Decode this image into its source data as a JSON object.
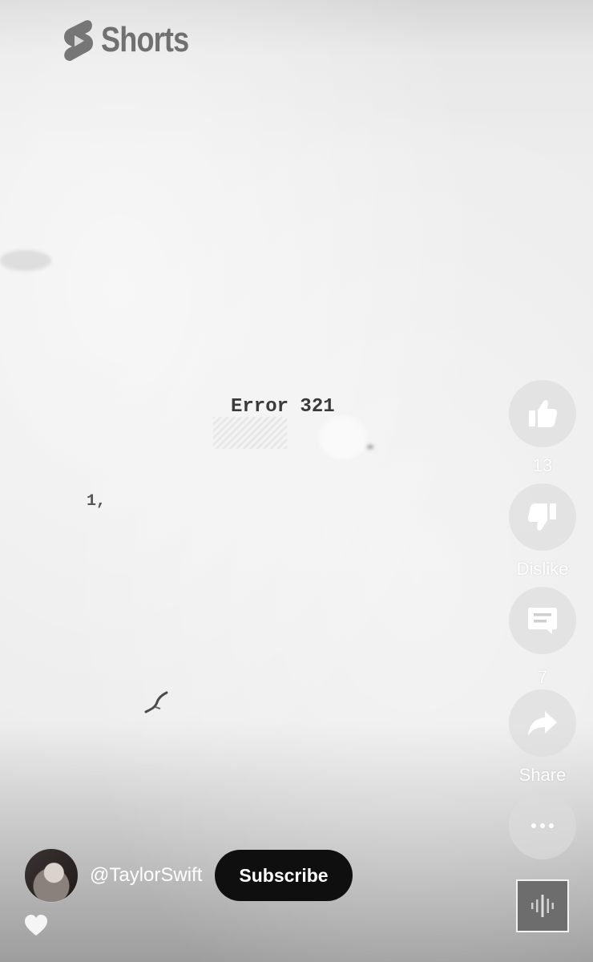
{
  "header": {
    "logo_text": "Shorts"
  },
  "video": {
    "typed_text_main": "Error 321",
    "typed_text_small": "1,"
  },
  "actions": {
    "like": {
      "icon": "thumbs-up-icon",
      "label": "13"
    },
    "dislike": {
      "icon": "thumbs-down-icon",
      "label": "Dislike"
    },
    "comments": {
      "icon": "comment-icon",
      "label": "7"
    },
    "share": {
      "icon": "share-icon",
      "label": "Share"
    },
    "more": {
      "icon": "more-horizontal-icon"
    }
  },
  "channel": {
    "handle": "@TaylorSwift",
    "subscribe_label": "Subscribe"
  },
  "colors": {
    "subscribe_bg": "#0f0f0f",
    "label_color": "#ffffff"
  }
}
